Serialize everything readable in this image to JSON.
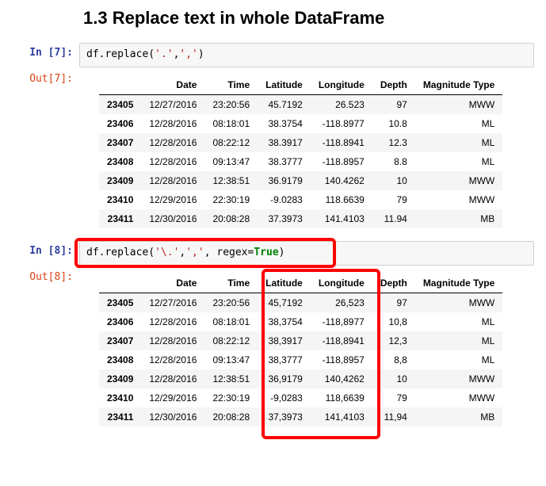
{
  "heading": "1.3  Replace text in whole DataFrame",
  "cells": {
    "c1": {
      "in_label": "In [7]:",
      "out_label": "Out[7]:",
      "code_pre": "df.replace(",
      "str1": "'.'",
      "comma": ",",
      "str2": "','",
      "code_post": ")"
    },
    "c2": {
      "in_label": "In [8]:",
      "out_label": "Out[8]:",
      "code_pre": "df.replace(",
      "str1": "'\\.'",
      "comma": ",",
      "str2": "','",
      "kwsep": ", regex=",
      "kwval": "True",
      "code_post": ")"
    }
  },
  "tables": {
    "t1": {
      "headers": [
        "Date",
        "Time",
        "Latitude",
        "Longitude",
        "Depth",
        "Magnitude Type"
      ],
      "index": [
        "23405",
        "23406",
        "23407",
        "23408",
        "23409",
        "23410",
        "23411"
      ],
      "rows": [
        [
          "12/27/2016",
          "23:20:56",
          "45.7192",
          "26.523",
          "97",
          "MWW"
        ],
        [
          "12/28/2016",
          "08:18:01",
          "38.3754",
          "-118.8977",
          "10.8",
          "ML"
        ],
        [
          "12/28/2016",
          "08:22:12",
          "38.3917",
          "-118.8941",
          "12.3",
          "ML"
        ],
        [
          "12/28/2016",
          "09:13:47",
          "38.3777",
          "-118.8957",
          "8.8",
          "ML"
        ],
        [
          "12/28/2016",
          "12:38:51",
          "36.9179",
          "140.4262",
          "10",
          "MWW"
        ],
        [
          "12/29/2016",
          "22:30:19",
          "-9.0283",
          "118.6639",
          "79",
          "MWW"
        ],
        [
          "12/30/2016",
          "20:08:28",
          "37.3973",
          "141.4103",
          "11.94",
          "MB"
        ]
      ]
    },
    "t2": {
      "headers": [
        "Date",
        "Time",
        "Latitude",
        "Longitude",
        "Depth",
        "Magnitude Type"
      ],
      "index": [
        "23405",
        "23406",
        "23407",
        "23408",
        "23409",
        "23410",
        "23411"
      ],
      "rows": [
        [
          "12/27/2016",
          "23:20:56",
          "45,7192",
          "26,523",
          "97",
          "MWW"
        ],
        [
          "12/28/2016",
          "08:18:01",
          "38,3754",
          "-118,8977",
          "10,8",
          "ML"
        ],
        [
          "12/28/2016",
          "08:22:12",
          "38,3917",
          "-118,8941",
          "12,3",
          "ML"
        ],
        [
          "12/28/2016",
          "09:13:47",
          "38,3777",
          "-118,8957",
          "8,8",
          "ML"
        ],
        [
          "12/28/2016",
          "12:38:51",
          "36,9179",
          "140,4262",
          "10",
          "MWW"
        ],
        [
          "12/29/2016",
          "22:30:19",
          "-9,0283",
          "118,6639",
          "79",
          "MWW"
        ],
        [
          "12/30/2016",
          "20:08:28",
          "37,3973",
          "141,4103",
          "11,94",
          "MB"
        ]
      ]
    }
  }
}
